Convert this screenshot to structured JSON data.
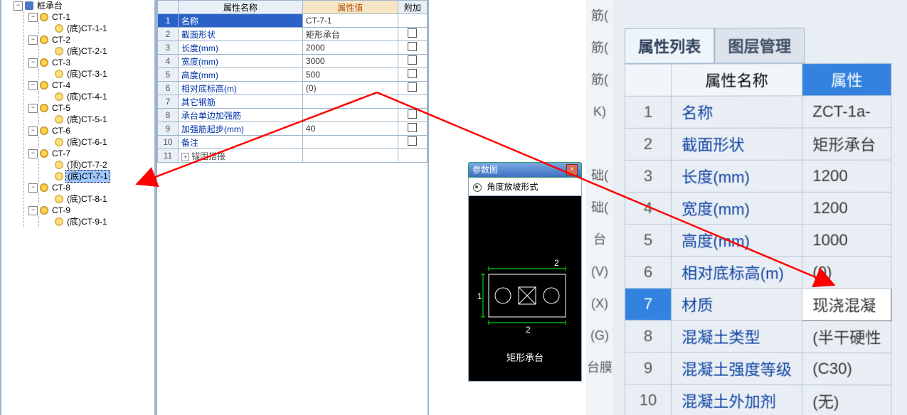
{
  "tree": {
    "root_label": "桩承台",
    "groups": [
      {
        "label": "CT-1",
        "children": [
          {
            "label": "(底)CT-1-1"
          }
        ]
      },
      {
        "label": "CT-2",
        "children": [
          {
            "label": "(底)CT-2-1"
          }
        ]
      },
      {
        "label": "CT-3",
        "children": [
          {
            "label": "(底)CT-3-1"
          }
        ]
      },
      {
        "label": "CT-4",
        "children": [
          {
            "label": "(底)CT-4-1"
          }
        ]
      },
      {
        "label": "CT-5",
        "children": [
          {
            "label": "(底)CT-5-1"
          }
        ]
      },
      {
        "label": "CT-6",
        "children": [
          {
            "label": "(底)CT-6-1"
          }
        ]
      },
      {
        "label": "CT-7",
        "children": [
          {
            "label": "(顶)CT-7-2"
          },
          {
            "label": "(底)CT-7-1",
            "selected": true
          }
        ]
      },
      {
        "label": "CT-8",
        "children": [
          {
            "label": "(底)CT-8-1"
          }
        ]
      },
      {
        "label": "CT-9",
        "children": [
          {
            "label": "(底)CT-9-1"
          }
        ]
      }
    ]
  },
  "prop_table": {
    "headers": {
      "name": "属性名称",
      "value": "属性值",
      "addon": "附加"
    },
    "rows": [
      {
        "n": "1",
        "name": "名称",
        "value": "CT-7-1",
        "addon": false,
        "selected": true
      },
      {
        "n": "2",
        "name": "截面形状",
        "value": "矩形承台",
        "addon": true
      },
      {
        "n": "3",
        "name": "长度(mm)",
        "value": "2000",
        "addon": true
      },
      {
        "n": "4",
        "name": "宽度(mm)",
        "value": "3000",
        "addon": true
      },
      {
        "n": "5",
        "name": "高度(mm)",
        "value": "500",
        "addon": true
      },
      {
        "n": "6",
        "name": "相对底标高(m)",
        "value": "(0)",
        "addon": true
      },
      {
        "n": "7",
        "name": "其它钢筋",
        "value": "",
        "addon": false
      },
      {
        "n": "8",
        "name": "承台单边加强筋",
        "value": "",
        "addon": true
      },
      {
        "n": "9",
        "name": "加强筋起步(mm)",
        "value": "40",
        "addon": true
      },
      {
        "n": "10",
        "name": "备注",
        "value": "",
        "addon": true
      },
      {
        "n": "11",
        "expander": true,
        "name": "锚固搭接",
        "value": "",
        "addon": false
      }
    ]
  },
  "param_win": {
    "title": "参数图",
    "option": "角度放坡形式",
    "caption": "矩形承台",
    "labels": {
      "left": "1",
      "top": "2",
      "bottom": "2"
    }
  },
  "photo": {
    "side_labels": [
      "筋(",
      "筋(",
      "筋(",
      "K)",
      "",
      "础(",
      "础(",
      "台(V)",
      "",
      "(X)",
      "(G)",
      "台膜"
    ],
    "tab_active": "属性列表",
    "tab_inactive": "图层管理",
    "headers": {
      "name": "属性名称",
      "value": "属性"
    },
    "rows": [
      {
        "n": "1",
        "name": "名称",
        "value": "ZCT-1a-"
      },
      {
        "n": "2",
        "name": "截面形状",
        "value": "矩形承台"
      },
      {
        "n": "3",
        "name": "长度(mm)",
        "value": "1200"
      },
      {
        "n": "4",
        "name": "宽度(mm)",
        "value": "1200"
      },
      {
        "n": "5",
        "name": "高度(mm)",
        "value": "1000"
      },
      {
        "n": "6",
        "name": "相对底标高(m)",
        "value": "(0)"
      },
      {
        "n": "7",
        "name": "材质",
        "value": "现浇混凝",
        "selected": true
      },
      {
        "n": "8",
        "name": "混凝土类型",
        "value": "(半干硬性"
      },
      {
        "n": "9",
        "name": "混凝土强度等级",
        "value": "(C30)"
      },
      {
        "n": "10",
        "name": "混凝土外加剂",
        "value": "(无)"
      }
    ]
  }
}
